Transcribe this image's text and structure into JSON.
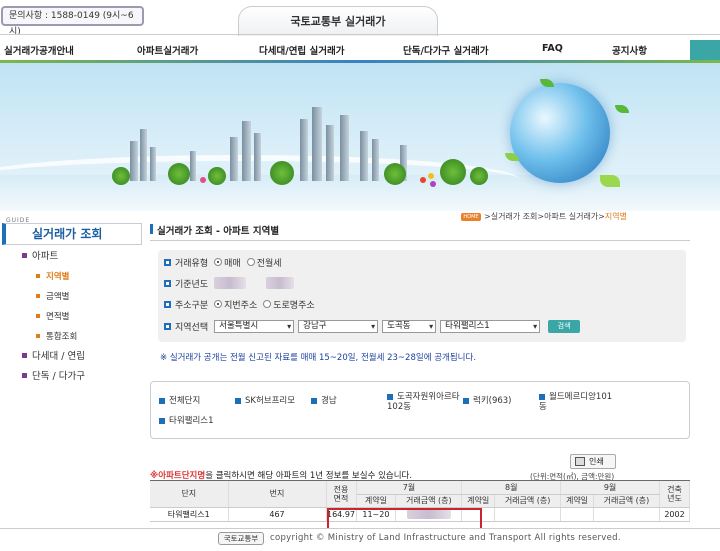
{
  "header": {
    "contact": "문의사항 : 1588-0149 (9시~6시)",
    "site_title": "국토교통부 실거래가"
  },
  "gnb": [
    "실거래가공개안내",
    "아파트실거래가",
    "다세대/연립 실거래가",
    "단독/다가구 실거래가",
    "FAQ",
    "공지사항"
  ],
  "lnb": {
    "guide": "GUIDE",
    "title": "실거래가 조회",
    "apt": "아파트",
    "sub": [
      "지역별",
      "금액별",
      "면적별",
      "통합조회"
    ],
    "villa": "다세대 / 연립",
    "house": "단독 / 다가구"
  },
  "breadcrumb": {
    "home": "HOME",
    "path": ">실거래가 조회>아파트 실거래가>",
    "current": "지역별"
  },
  "section_title": "실거래가 조회 - 아파트 지역별",
  "form": {
    "deal_type_label": "거래유형",
    "deal_sale": "매매",
    "deal_rent": "전월세",
    "year_label": "기준년도",
    "addr_label": "주소구분",
    "addr_jibun": "지번주소",
    "addr_road": "도로명주소",
    "region_label": "지역선택",
    "sido": "서울특별시",
    "gu": "강남구",
    "dong": "도곡동",
    "apt": "타워팰리스1",
    "search": "검색"
  },
  "notice": "※ 실거래가 공개는 전월 신고된 자료를 매매 15~20일, 전월세 23~28일에 공개됩니다.",
  "complex_list": [
    "전체단지",
    "SK허브프리모",
    "경남",
    "도곡자원위아르타\n102동",
    "럭키(963)",
    "월드메르디앙101\n동",
    "타워팰리스1"
  ],
  "print": "인쇄",
  "hint_red": "※아파트단지명",
  "hint_rest": "을 클릭하시면 해당 아파트의 1년 정보를 보실수 있습니다.",
  "unit": "(단위:면적(㎡), 금액:만원)",
  "table": {
    "h_danji": "단지",
    "h_bunji": "번지",
    "h_area": "전용\n면적",
    "m7": "7월",
    "m8": "8월",
    "m9": "9월",
    "h_year": "건축\n년도",
    "h_contract": "계약일",
    "h_amount": "거래금액 (층)",
    "row": {
      "danji": "타워팰리스1",
      "bunji": "467",
      "area": "164.97",
      "contract": "11~20",
      "year": "2002"
    }
  },
  "footer": {
    "logo": "국토교통부",
    "copyright": "copyright © Ministry of Land Infrastructure and Transport All rights reserved."
  }
}
